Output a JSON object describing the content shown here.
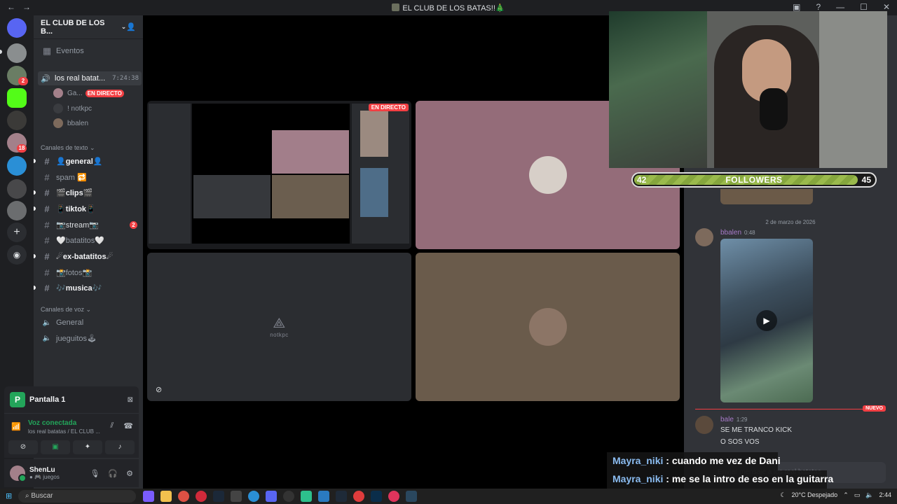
{
  "window": {
    "title": "EL CLUB DE LOS BATAS!!🎄",
    "back": "←",
    "forward": "→",
    "controls": [
      "▣",
      "?",
      "—",
      "☐",
      "✕"
    ]
  },
  "sidebar": {
    "server_name": "EL CLUB DE LOS B...",
    "events": "Eventos",
    "active_voice": {
      "name": "los real batat...",
      "timer": "7:24:38"
    },
    "voice_members": [
      {
        "name": "Ga...",
        "live": "EN DIRECTO"
      },
      {
        "name": "! notkpc"
      },
      {
        "name": "bbalen"
      }
    ],
    "text_category": "Canales de texto",
    "text_channels": [
      {
        "name": "👤general👤",
        "unread": true
      },
      {
        "name": "spam 🔁",
        "unread": false
      },
      {
        "name": "🎬clips🎬",
        "unread": true
      },
      {
        "name": "📱tiktok📱",
        "unread": true
      },
      {
        "name": "📷stream📷",
        "unread": false,
        "badge": "2"
      },
      {
        "name": "🤍batatitos🤍",
        "unread": false
      },
      {
        "name": "☄ex-batatitos☄",
        "unread": true
      },
      {
        "name": "📸fotos📸",
        "unread": false
      },
      {
        "name": "🎶musica🎶",
        "unread": true
      }
    ],
    "voice_category": "Canales de voz",
    "voice_channels": [
      "General",
      "jueguitos🕹"
    ]
  },
  "rail": {
    "badges": [
      "2",
      "18"
    ]
  },
  "screen_share": {
    "label": "Pantalla 1",
    "app_initial": "P"
  },
  "voice_status": {
    "status": "Voz conectada",
    "channel": "los real batatas / EL CLUB ..."
  },
  "user": {
    "name": "ShenLu",
    "activity": "● 🎮 juegos"
  },
  "stage": {
    "live_label": "EN DIRECTO",
    "notkpc_label": "notkpc"
  },
  "chat": {
    "date_divider": "2 de marzo de 2026",
    "messages": [
      {
        "author": "bbalen",
        "time": "0:48",
        "color": "#a77ac8"
      },
      {
        "author": "bale",
        "time": "1:29",
        "color": "#a77ac8",
        "lines": [
          "SE ME TRANCO KICK",
          "O SOS VOS"
        ]
      }
    ],
    "new_label": "NUEVO",
    "input_placeholder": "Enviar mensaje a los real batatas"
  },
  "overlay": {
    "followers_current": "42",
    "followers_label": "FOLLOWERS",
    "followers_goal": "45",
    "followers_progress": 0.933,
    "stream_chat": [
      {
        "user": "Mayra_niki",
        "text": " : cuando me vez de Dani"
      },
      {
        "user": "Mayra_niki",
        "text": " : me se la intro de eso en la guitarra"
      }
    ]
  },
  "taskbar": {
    "search": "Buscar",
    "weather": "20°C  Despejado",
    "time": "2:44"
  },
  "colors": {
    "accent_green": "#23a55a",
    "live_red": "#f23f43",
    "blurple": "#5865f2"
  }
}
